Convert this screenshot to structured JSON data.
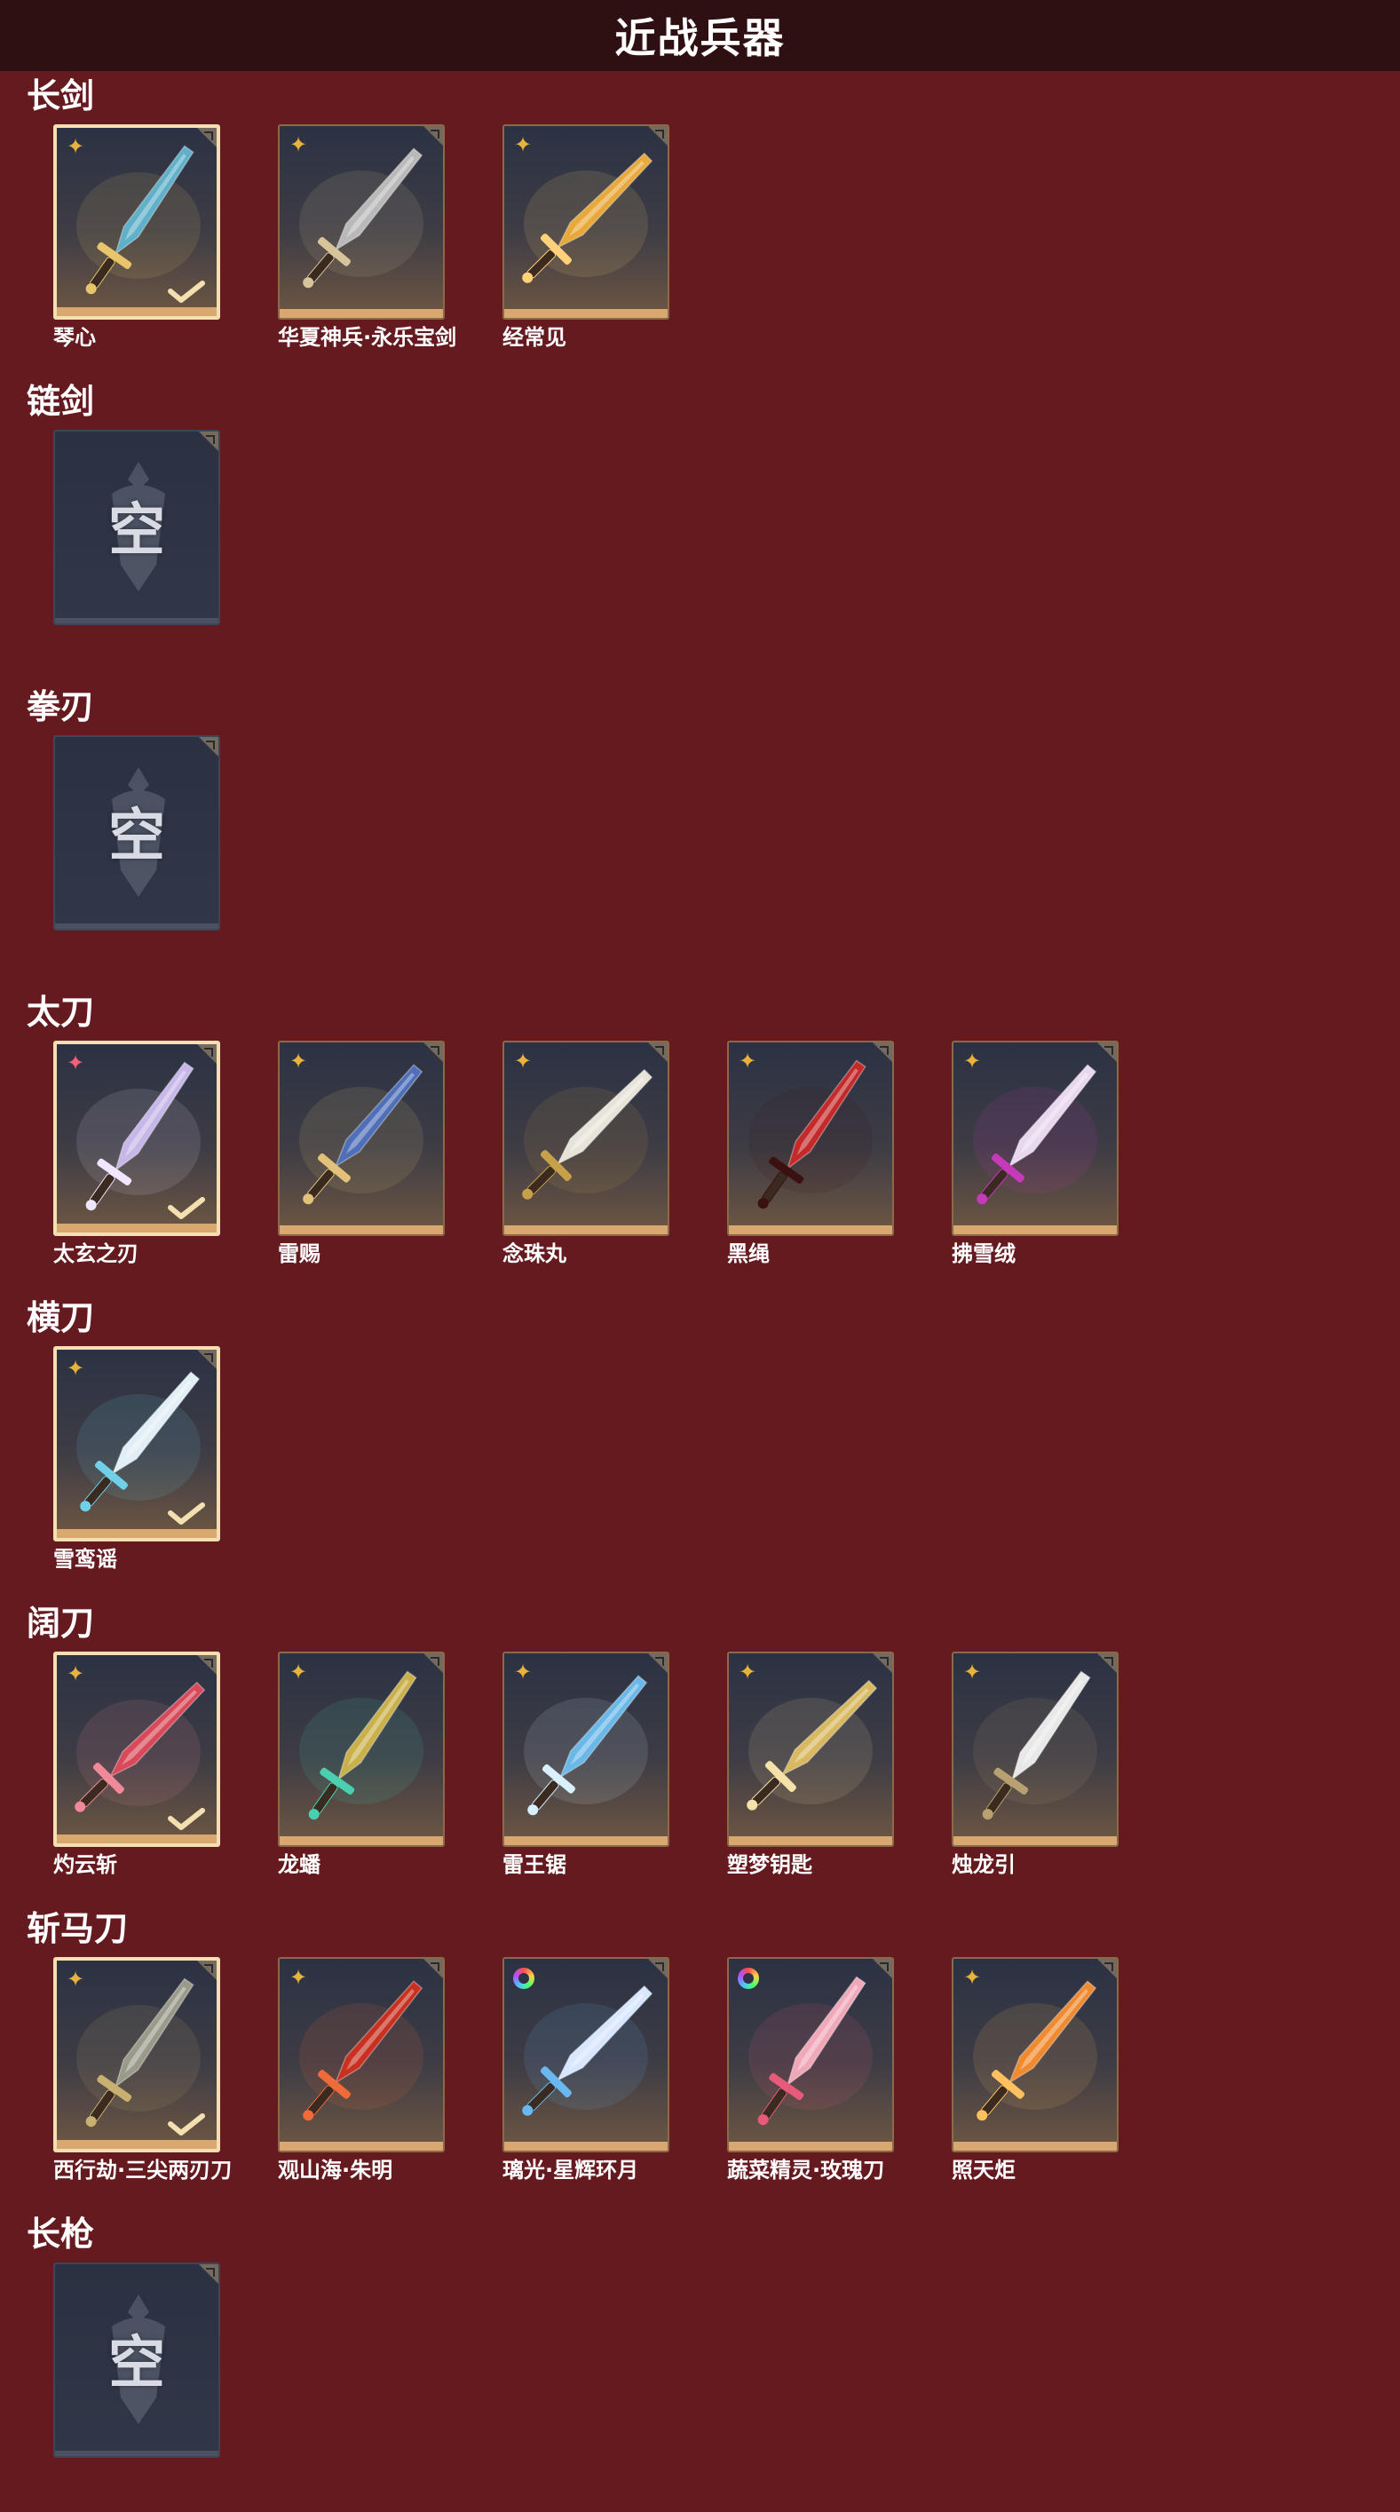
{
  "header": {
    "title": "近战兵器"
  },
  "sections": [
    {
      "title": "长剑",
      "items": [
        {
          "name": "琴心",
          "selected": true,
          "rarity": "gold",
          "color": "#5fb0c8",
          "accent": "#e8c46a"
        },
        {
          "name": "华夏神兵·永乐宝剑",
          "selected": false,
          "rarity": "gold",
          "color": "#b9b9b9",
          "accent": "#d8c49a"
        },
        {
          "name": "经常见",
          "selected": false,
          "rarity": "gold",
          "color": "#e8a83a",
          "accent": "#ffd27a"
        }
      ]
    },
    {
      "title": "链剑",
      "items": [
        {
          "empty": true,
          "empty_text": "空"
        }
      ]
    },
    {
      "title": "拳刃",
      "items": [
        {
          "empty": true,
          "empty_text": "空"
        }
      ]
    },
    {
      "title": "太刀",
      "items": [
        {
          "name": "太玄之刃",
          "selected": true,
          "rarity": "pink",
          "color": "#c7b6e8",
          "accent": "#f0e6ff"
        },
        {
          "name": "雷赐",
          "selected": false,
          "rarity": "gold",
          "color": "#4f6fb8",
          "accent": "#e2c27a"
        },
        {
          "name": "念珠丸",
          "selected": false,
          "rarity": "gold",
          "color": "#e7e3d8",
          "accent": "#c9a04a"
        },
        {
          "name": "黑绳",
          "selected": false,
          "rarity": "gold",
          "color": "#c42a2a",
          "accent": "#3a1010"
        },
        {
          "name": "拂雪绒",
          "selected": false,
          "rarity": "gold",
          "color": "#e8d8ee",
          "accent": "#c43ab8"
        }
      ]
    },
    {
      "title": "横刀",
      "items": [
        {
          "name": "雪鸾谣",
          "selected": true,
          "rarity": "gold",
          "color": "#e2eef5",
          "accent": "#6fd0e8"
        }
      ]
    },
    {
      "title": "阔刀",
      "items": [
        {
          "name": "灼云斩",
          "selected": true,
          "rarity": "gold",
          "color": "#d84a5a",
          "accent": "#f08a9a"
        },
        {
          "name": "龙蟠",
          "selected": false,
          "rarity": "gold",
          "color": "#c9b04a",
          "accent": "#4ad0b0"
        },
        {
          "name": "雷王锯",
          "selected": false,
          "rarity": "gold",
          "color": "#6ab8e8",
          "accent": "#d8f0ff"
        },
        {
          "name": "塑梦钥匙",
          "selected": false,
          "rarity": "gold",
          "color": "#d8b860",
          "accent": "#f5e2a8"
        },
        {
          "name": "烛龙引",
          "selected": false,
          "rarity": "gold",
          "color": "#e8e8e8",
          "accent": "#b8a070"
        }
      ]
    },
    {
      "title": "斩马刀",
      "items": [
        {
          "name": "西行劫·三尖两刃刀",
          "selected": true,
          "rarity": "gold",
          "color": "#9a9a8a",
          "accent": "#c8b070"
        },
        {
          "name": "观山海·朱明",
          "selected": false,
          "rarity": "gold",
          "color": "#c83020",
          "accent": "#f06a3a"
        },
        {
          "name": "璃光·星辉环月",
          "selected": false,
          "rarity": "ring",
          "color": "#d8e6ff",
          "accent": "#6ab8f0"
        },
        {
          "name": "蔬菜精灵·玫瑰刀",
          "selected": false,
          "rarity": "ring",
          "color": "#f0a8b8",
          "accent": "#e85a7a"
        },
        {
          "name": "照天炬",
          "selected": false,
          "rarity": "gold",
          "color": "#f08a30",
          "accent": "#ffc060"
        }
      ]
    },
    {
      "title": "长枪",
      "items": [
        {
          "empty": true,
          "empty_text": "空"
        }
      ]
    }
  ]
}
